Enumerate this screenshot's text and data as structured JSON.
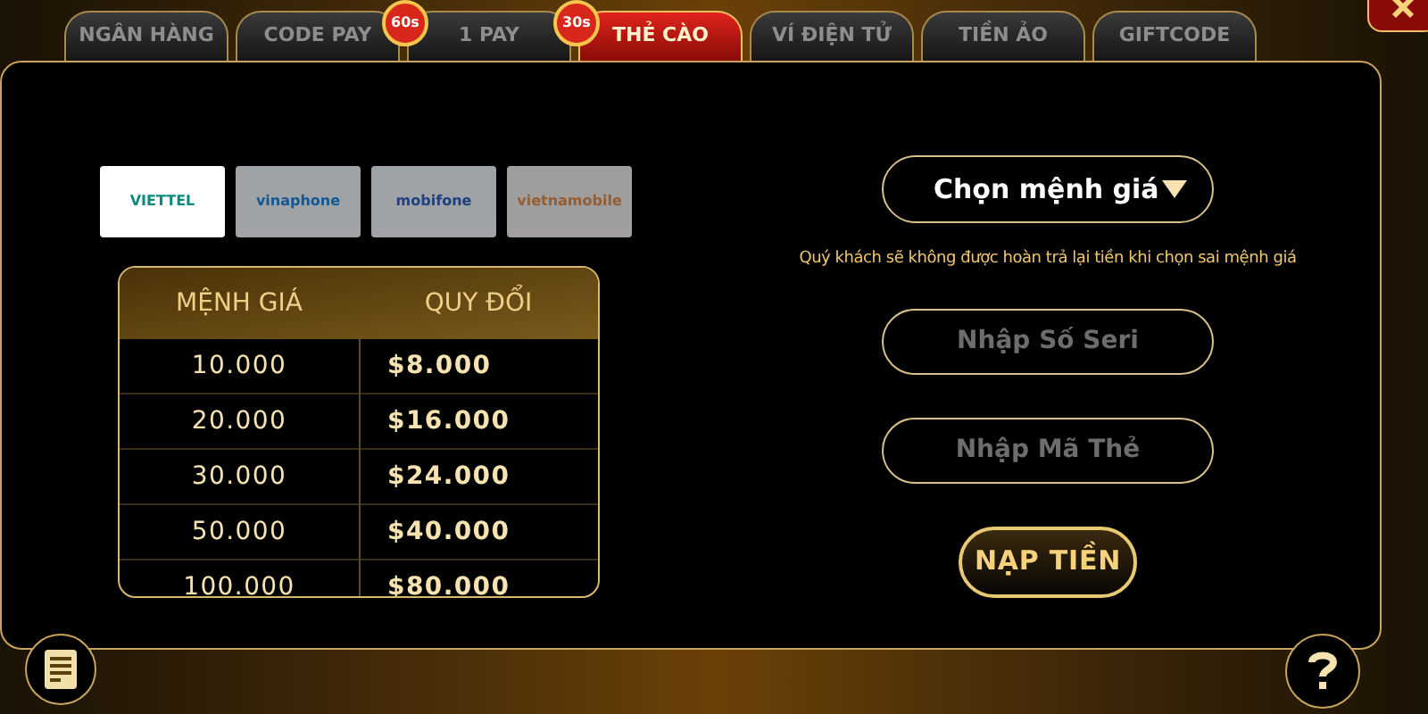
{
  "tabs": [
    {
      "label": "NGÂN HÀNG",
      "selected": false
    },
    {
      "label": "CODE PAY",
      "selected": false,
      "badge": "60s"
    },
    {
      "label": "1 PAY",
      "selected": false,
      "badge": "30s"
    },
    {
      "label": "THẺ CÀO",
      "selected": true
    },
    {
      "label": "VÍ ĐIỆN TỬ",
      "selected": false
    },
    {
      "label": "TIỀN ẢO",
      "selected": false
    },
    {
      "label": "GIFTCODE",
      "selected": false
    }
  ],
  "carriers": [
    {
      "label": "VIETTEL",
      "selected": true
    },
    {
      "label": "vinaphone",
      "selected": false
    },
    {
      "label": "mobifone",
      "selected": false
    },
    {
      "label": "vietnamobile",
      "selected": false
    }
  ],
  "rate_table": {
    "columns": [
      "MỆNH GIÁ",
      "QUY ĐỔI"
    ],
    "rows": [
      {
        "value": "10.000",
        "exchange": "$8.000"
      },
      {
        "value": "20.000",
        "exchange": "$16.000"
      },
      {
        "value": "30.000",
        "exchange": "$24.000"
      },
      {
        "value": "50.000",
        "exchange": "$40.000"
      },
      {
        "value": "100.000",
        "exchange": "$80.000"
      }
    ]
  },
  "denomination_select": {
    "value": "Chọn mệnh giá"
  },
  "notice": "Quý khách sẽ không được hoàn trả lại tiền khi chọn sai mệnh giá",
  "serial_field": {
    "placeholder": "Nhập Số Seri"
  },
  "code_field": {
    "placeholder": "Nhập Mã Thẻ"
  },
  "submit_button": "NẠP TIỀN"
}
